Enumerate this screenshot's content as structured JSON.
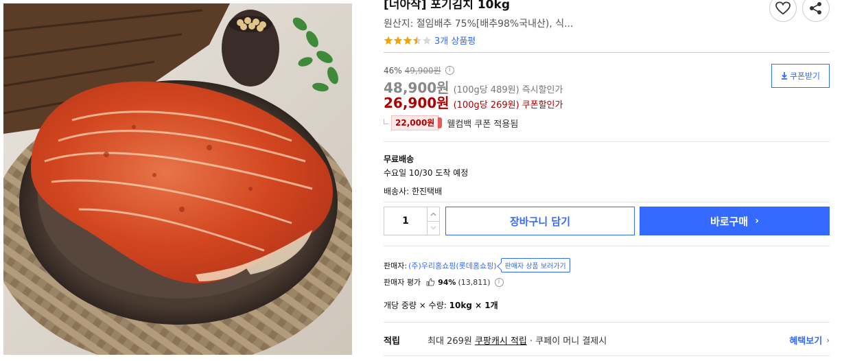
{
  "product": {
    "title": "[너아작] 포기김치 10kg",
    "origin": "원산지: 절임배추 75%[배추98%국내산), 식...",
    "rating_stars": 3.5,
    "review_link": "3개 상품평",
    "image_alt": "포기김치 상품 이미지"
  },
  "icons": {
    "wish": "heart-icon",
    "share": "share-icon",
    "info": "info-icon",
    "download": "download-icon",
    "thumb": "thumbs-up-icon"
  },
  "price": {
    "discount_rate": "46%",
    "original_price": "49,900원",
    "info_glyph": "i",
    "instant_price": "48,900원",
    "instant_unit": "(100g당 489원)",
    "instant_label": "즉시할인가",
    "coupon_price": "26,900원",
    "coupon_unit": "(100g당 269원)",
    "coupon_label": "쿠폰할인가",
    "coupon_button": "쿠폰받기",
    "welcome_amount": "22,000원",
    "welcome_text": "웰컴백 쿠폰 적용됨"
  },
  "shipping": {
    "title": "무료배송",
    "arrival": "수요일 10/30 도착 예정",
    "courier": "배송사: 한진택배"
  },
  "purchase": {
    "quantity": "1",
    "cart_button": "장바구니 담기",
    "buy_button": "바로구매",
    "buy_chevron": "›"
  },
  "seller": {
    "label": "판매자:",
    "name": "(주)우리홈쇼핑(롯데홈쇼핑)",
    "products_link": "판매자 상품 보러가기",
    "rating_label": "판매자 평가",
    "rating_pct": "94%",
    "rating_count": "(13,811)"
  },
  "option": {
    "label": "개당 중량 × 수량:",
    "value": "10kg × 1개"
  },
  "points": {
    "label": "적립",
    "text_prefix": "최대 269원",
    "text_link": "쿠팡캐시 적립",
    "text_suffix": "· 쿠페이 머니 결제시",
    "benefit_link": "혜택보기"
  },
  "colors": {
    "accent_blue": "#346aff",
    "sale_red": "#ae0000",
    "star_yellow": "#f6a500"
  }
}
